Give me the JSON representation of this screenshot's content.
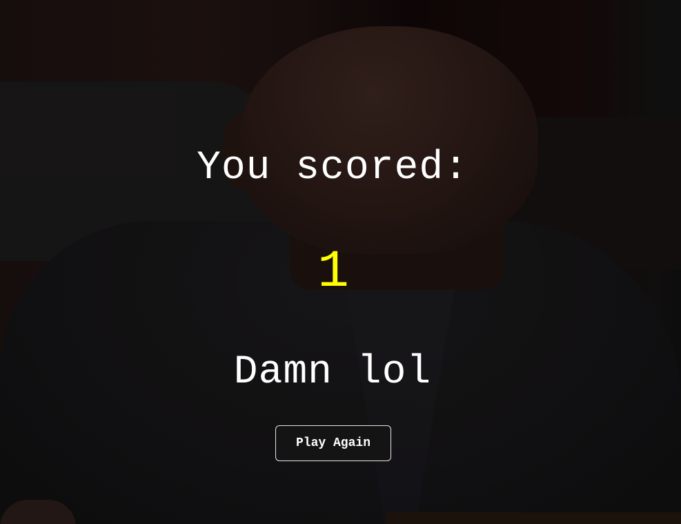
{
  "result": {
    "heading": "You scored:",
    "score": "1",
    "message": "Damn lol",
    "play_again_label": "Play Again"
  },
  "colors": {
    "score": "#ffff00",
    "text": "#ffffff",
    "button_border": "#e6e6e6"
  },
  "background": {
    "image": "dimmed photo of a bald man in a dark suit with a shocked expression"
  }
}
